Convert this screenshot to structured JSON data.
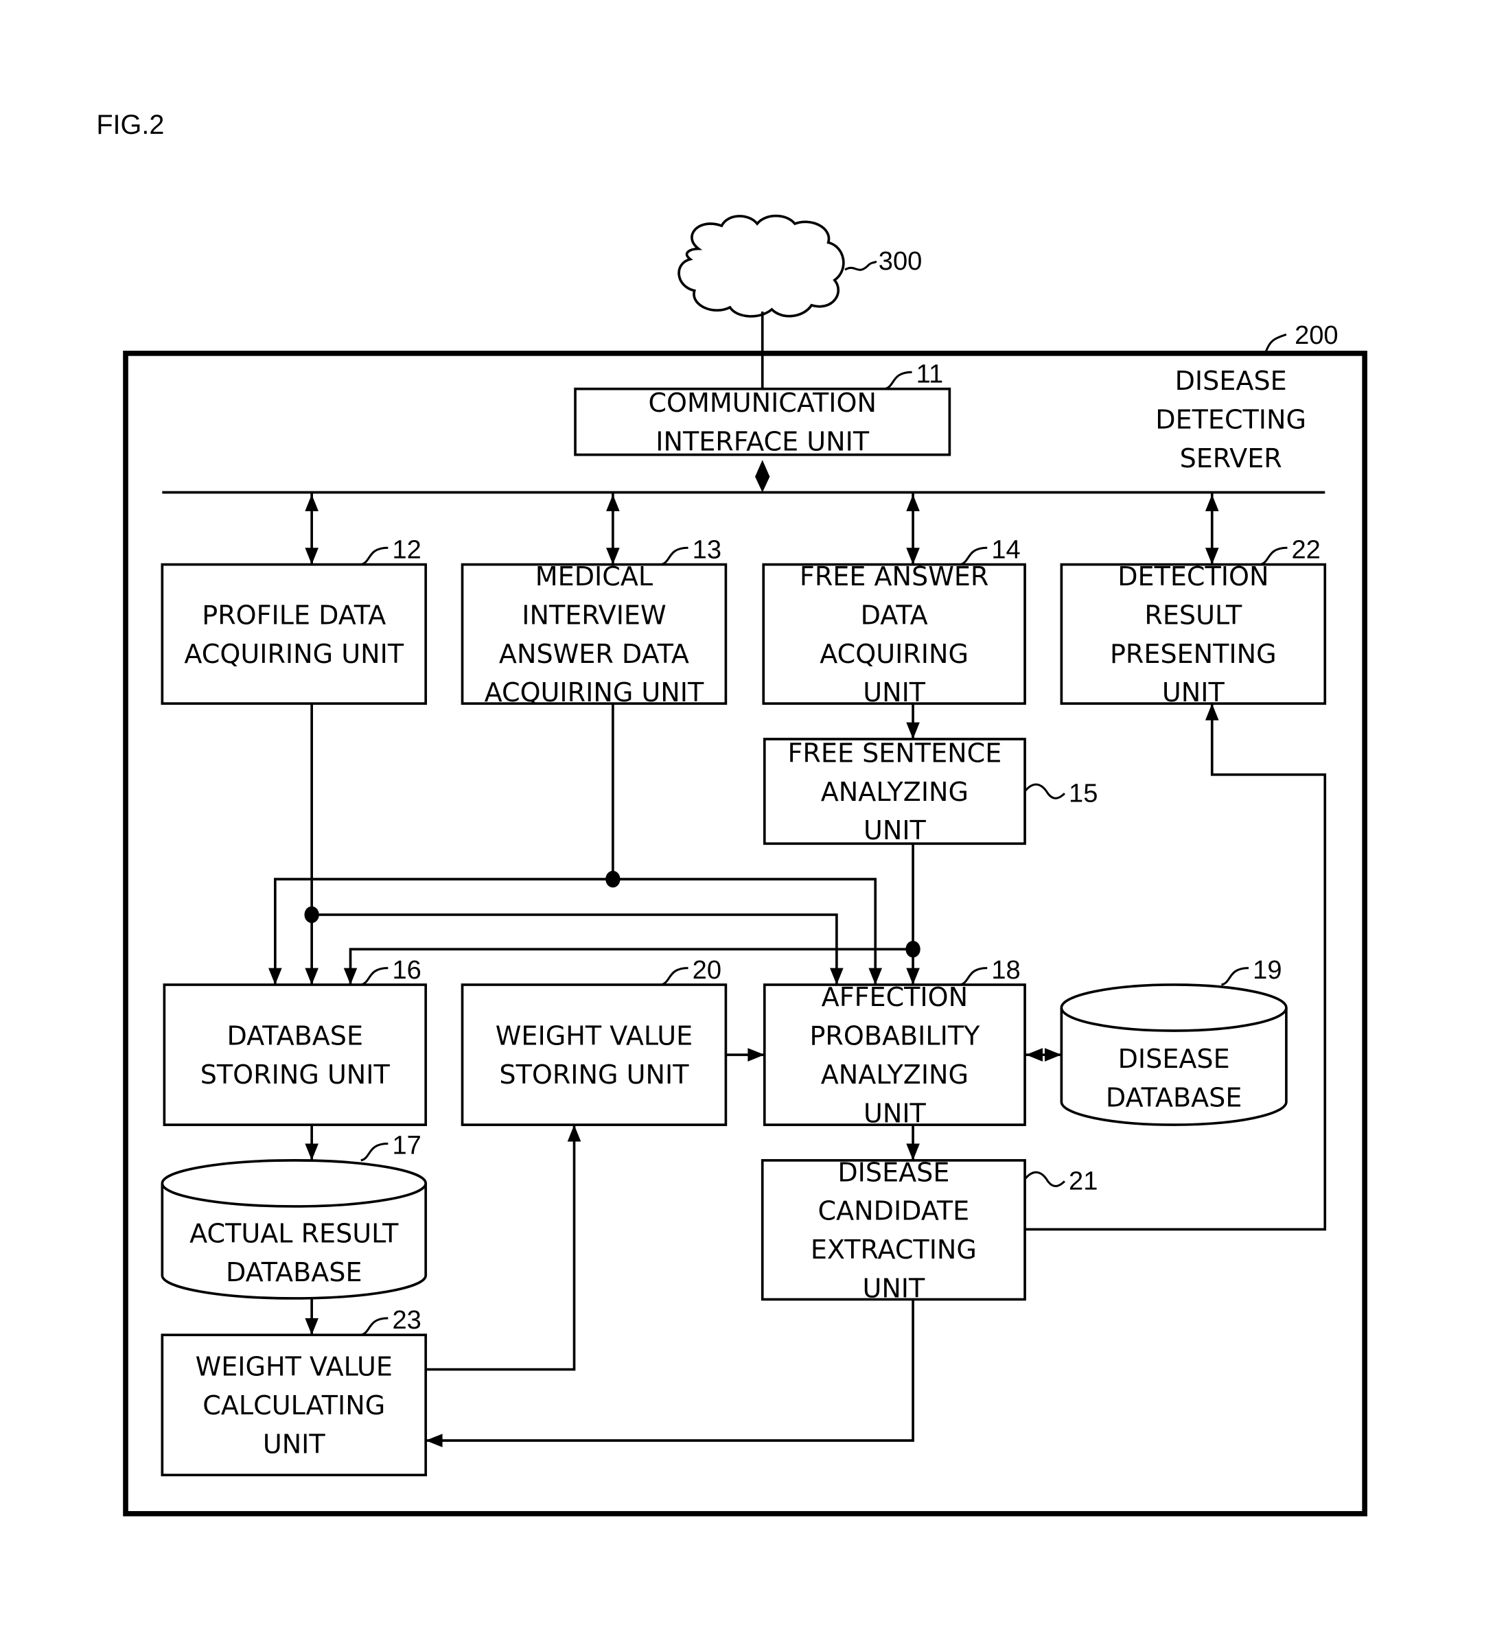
{
  "figure": {
    "title": "FIG.2"
  },
  "network": {
    "ref": "300"
  },
  "server": {
    "ref": "200",
    "title_lines": [
      "DISEASE",
      "DETECTING",
      "SERVER"
    ]
  },
  "units": {
    "u11": {
      "ref": "11",
      "lines": [
        "COMMUNICATION",
        "INTERFACE UNIT"
      ]
    },
    "u12": {
      "ref": "12",
      "lines": [
        "PROFILE DATA",
        "ACQUIRING UNIT"
      ]
    },
    "u13": {
      "ref": "13",
      "lines": [
        "MEDICAL",
        "INTERVIEW",
        "ANSWER DATA",
        "ACQUIRING UNIT"
      ]
    },
    "u14": {
      "ref": "14",
      "lines": [
        "FREE ANSWER",
        "DATA",
        "ACQUIRING",
        "UNIT"
      ]
    },
    "u22": {
      "ref": "22",
      "lines": [
        "DETECTION",
        "RESULT",
        "PRESENTING",
        "UNIT"
      ]
    },
    "u15": {
      "ref": "15",
      "lines": [
        "FREE SENTENCE",
        "ANALYZING",
        "UNIT"
      ]
    },
    "u16": {
      "ref": "16",
      "lines": [
        "DATABASE",
        "STORING UNIT"
      ]
    },
    "u20": {
      "ref": "20",
      "lines": [
        "WEIGHT VALUE",
        "STORING UNIT"
      ]
    },
    "u18": {
      "ref": "18",
      "lines": [
        "AFFECTION",
        "PROBABILITY",
        "ANALYZING",
        "UNIT"
      ]
    },
    "u19": {
      "ref": "19",
      "lines": [
        "DISEASE",
        "DATABASE"
      ]
    },
    "u17": {
      "ref": "17",
      "lines": [
        "ACTUAL RESULT",
        "DATABASE"
      ]
    },
    "u21": {
      "ref": "21",
      "lines": [
        "DISEASE",
        "CANDIDATE",
        "EXTRACTING",
        "UNIT"
      ]
    },
    "u23": {
      "ref": "23",
      "lines": [
        "WEIGHT VALUE",
        "CALCULATING",
        "UNIT"
      ]
    }
  }
}
